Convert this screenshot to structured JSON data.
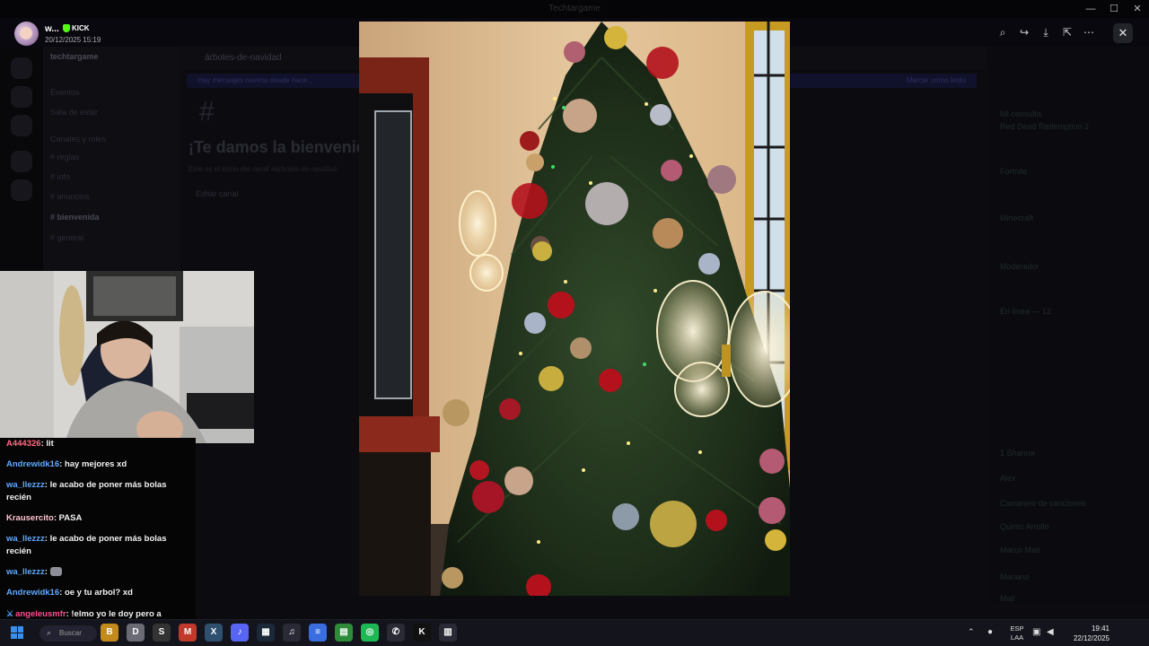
{
  "system": {
    "window_title": "Techtargame",
    "minimize": "—",
    "maximize": "☐",
    "close": "✕"
  },
  "viewer": {
    "author_name": "w...",
    "badge": "KICK",
    "timestamp": "20/12/2025 15:19",
    "tools": {
      "zoom": "⌕",
      "forward": "↪",
      "download": "⤓",
      "open_external": "⇱",
      "more": "⋯",
      "close": "✕"
    }
  },
  "background": {
    "server_name": "techtargame",
    "channel_title": "árboles-de-navidad",
    "banner_left": "Hay mensajes nuevos desde hace...",
    "banner_right": "Marcar como leído",
    "welcome_heading": "¡Te damos la bienvenida a #árboles-de-navidad!",
    "welcome_sub": "Este es el inicio del canal #árboles-de-navidad.",
    "edit_channel": "Editar canal",
    "channels": [
      "Eventos",
      "Sala de estar",
      "Canales y roles",
      "# reglas",
      "# info",
      "# anuncios",
      "# bienvenida",
      "# general"
    ],
    "members": [
      "MI consulta",
      "Red Dead Redemption 2",
      "Fortnite",
      "Minecraft",
      "Moderador",
      "En línea — 12",
      "1 Shanna",
      "Alex",
      "Camarero de canciones",
      "Quinto Arrollo",
      "Marco Mati",
      "Mariano",
      "Mali"
    ]
  },
  "chat": {
    "lines": [
      {
        "user": "A444326",
        "user_color": "#ff6b81",
        "text": "lit"
      },
      {
        "user": "Andrewidk16",
        "user_color": "#5fa8ff",
        "text": "hay mejores xd"
      },
      {
        "user": "wa_llezzz",
        "user_color": "#5fa8ff",
        "text": "le acabo de poner más bolas recién"
      },
      {
        "user": "Krausercito",
        "user_color": "#ffc2cf",
        "text": "PASA"
      },
      {
        "user": "wa_llezzz",
        "user_color": "#5fa8ff",
        "text": "le acabo de poner más bolas recién"
      },
      {
        "user": "wa_llezzz",
        "user_color": "#5fa8ff",
        "text": ""
      },
      {
        "user": "Andrewidk16",
        "user_color": "#5fa8ff",
        "text": "oe y tu arbol? xd"
      },
      {
        "user": "angeleusmfr",
        "user_color": "#ff4d8d",
        "text": "!elmo yo le doy pero a modres si no me da ceo pasado mañana"
      }
    ]
  },
  "taskbar": {
    "search_placeholder": "Buscar",
    "apps": [
      "B",
      "D",
      "S",
      "M",
      "X",
      "♪",
      "▦",
      "♫",
      "≡",
      "▤",
      "◎",
      "✆",
      "K",
      "▥"
    ],
    "lang_top": "ESP",
    "lang_bottom": "LAA",
    "time": "19:41",
    "date": "22/12/2025",
    "colors": {
      "accent": "#3d8ee8",
      "kick_green": "#53fc18",
      "discord": "#5865f2",
      "spotify": "#1db954"
    }
  }
}
